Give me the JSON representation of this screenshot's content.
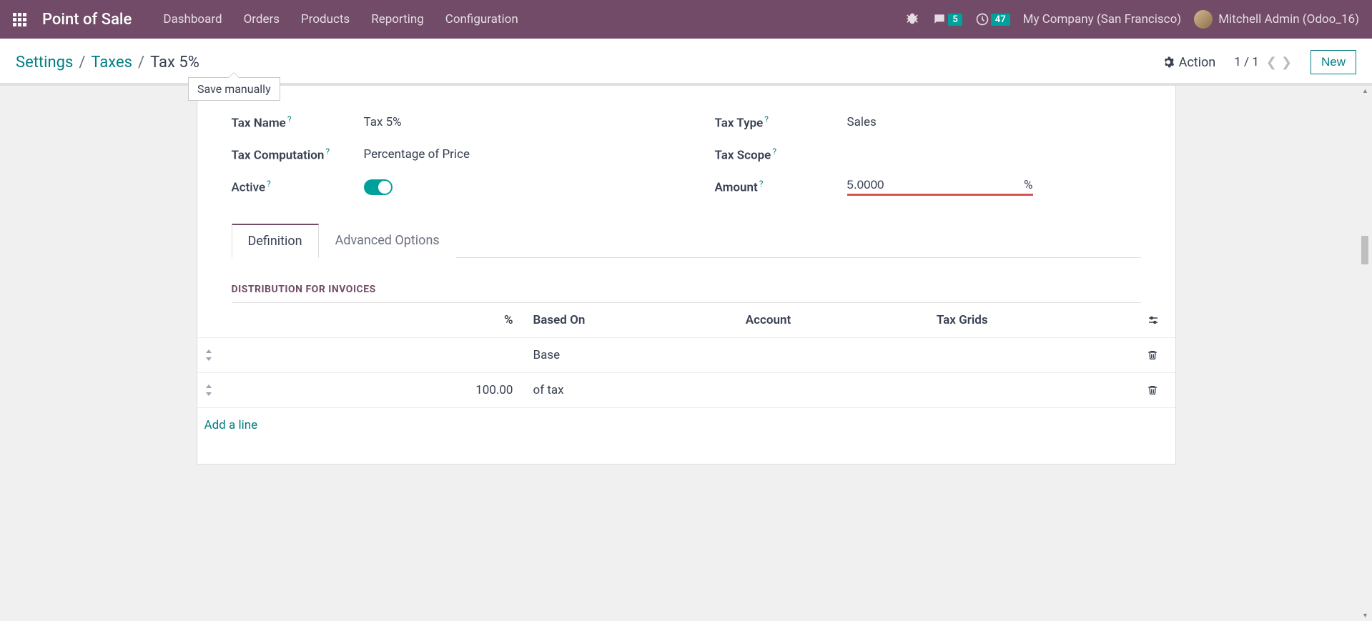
{
  "topnav": {
    "brand": "Point of Sale",
    "links": [
      "Dashboard",
      "Orders",
      "Products",
      "Reporting",
      "Configuration"
    ],
    "messages_badge": "5",
    "activities_badge": "47",
    "company": "My Company (San Francisco)",
    "user": "Mitchell Admin (Odoo_16)"
  },
  "breadcrumb": {
    "root": "Settings",
    "parent": "Taxes",
    "current": "Tax 5%"
  },
  "tooltip": "Save manually",
  "actions": {
    "action_label": "Action",
    "pager": "1 / 1",
    "new_label": "New"
  },
  "form": {
    "tax_name_label": "Tax Name",
    "tax_name_value": "Tax 5%",
    "tax_computation_label": "Tax Computation",
    "tax_computation_value": "Percentage of Price",
    "active_label": "Active",
    "tax_type_label": "Tax Type",
    "tax_type_value": "Sales",
    "tax_scope_label": "Tax Scope",
    "amount_label": "Amount",
    "amount_value": "5.0000",
    "amount_suffix": "%"
  },
  "tabs": {
    "definition": "Definition",
    "advanced": "Advanced Options"
  },
  "distribution": {
    "title": "DISTRIBUTION FOR INVOICES",
    "headers": {
      "pct": "%",
      "based_on": "Based On",
      "account": "Account",
      "tax_grids": "Tax Grids"
    },
    "rows": [
      {
        "pct": "",
        "based_on": "Base"
      },
      {
        "pct": "100.00",
        "based_on": "of tax"
      }
    ],
    "add_line": "Add a line"
  }
}
